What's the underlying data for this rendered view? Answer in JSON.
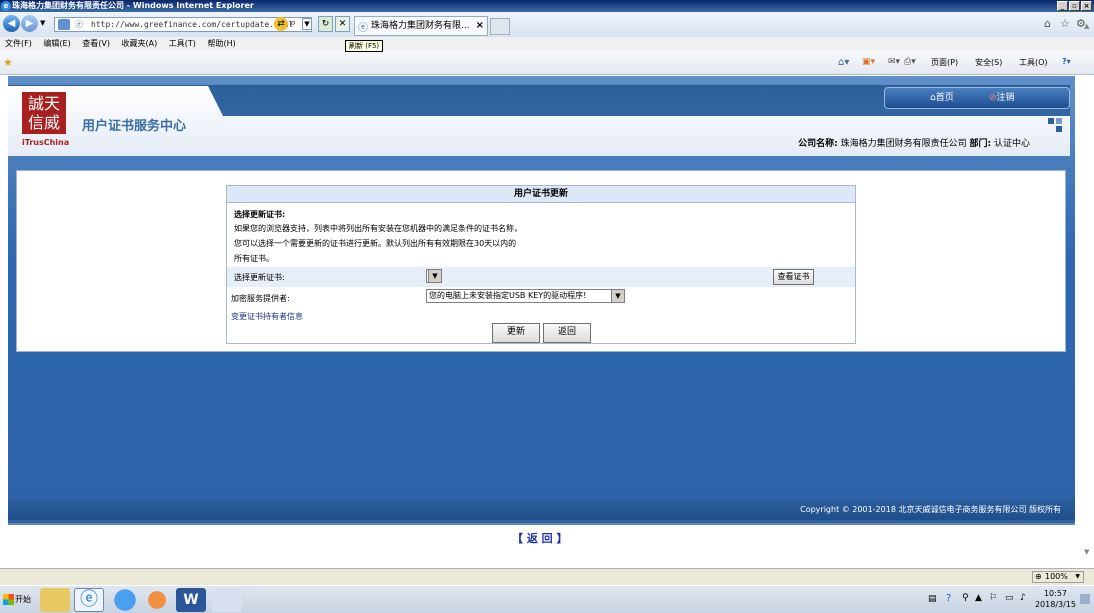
{
  "window": {
    "title": "珠海格力集团财务有限责任公司 - Windows Internet Explorer"
  },
  "browser": {
    "address": "http://www.greefinance.com/certupdate.html",
    "tab_title": "珠海格力集团财务有限...",
    "tooltip": "刷新 (F5)"
  },
  "menu": [
    "文件(F)",
    "编辑(E)",
    "查看(V)",
    "收藏夹(A)",
    "工具(T)",
    "帮助(H)"
  ],
  "command_bar": {
    "page": "页面(P)",
    "safety": "安全(S)",
    "tools": "工具(O)"
  },
  "logo": {
    "line1": "誠天",
    "line2": "信威",
    "sub": "iTrusChina"
  },
  "site": {
    "title": "用户证书服务中心",
    "nav_home": "首页",
    "nav_logout": "注销",
    "company_label": "公司名称:",
    "company_name": "珠海格力集团财务有限责任公司",
    "dept_label": "部门:",
    "dept_name": "认证中心"
  },
  "panel": {
    "title": "用户证书更新",
    "heading": "选择更新证书:",
    "desc1": "如果您的浏览器支持，列表中将列出所有安装在您机器中的满足条件的证书名称，",
    "desc2": "您可以选择一个需要更新的证书进行更新。默认列出所有有效期限在30天以内的",
    "desc3": "所有证书。",
    "select_cert_label": "选择更新证书:",
    "view_cert": "查看证书",
    "csp_label": "加密服务提供者:",
    "csp_value": "您的电脑上未安装指定USB KEY的驱动程序!",
    "change_holder": "变更证书持有者信息",
    "update": "更新",
    "back": "返回"
  },
  "footer": {
    "copyright": "Copyright © 2001-2018 北京天威诚信电子商务服务有限公司 版权所有",
    "back_link": "【 返 回 】"
  },
  "status": {
    "zoom": "100%"
  },
  "taskbar": {
    "start": "开始",
    "time": "10:57",
    "date": "2018/3/15"
  }
}
